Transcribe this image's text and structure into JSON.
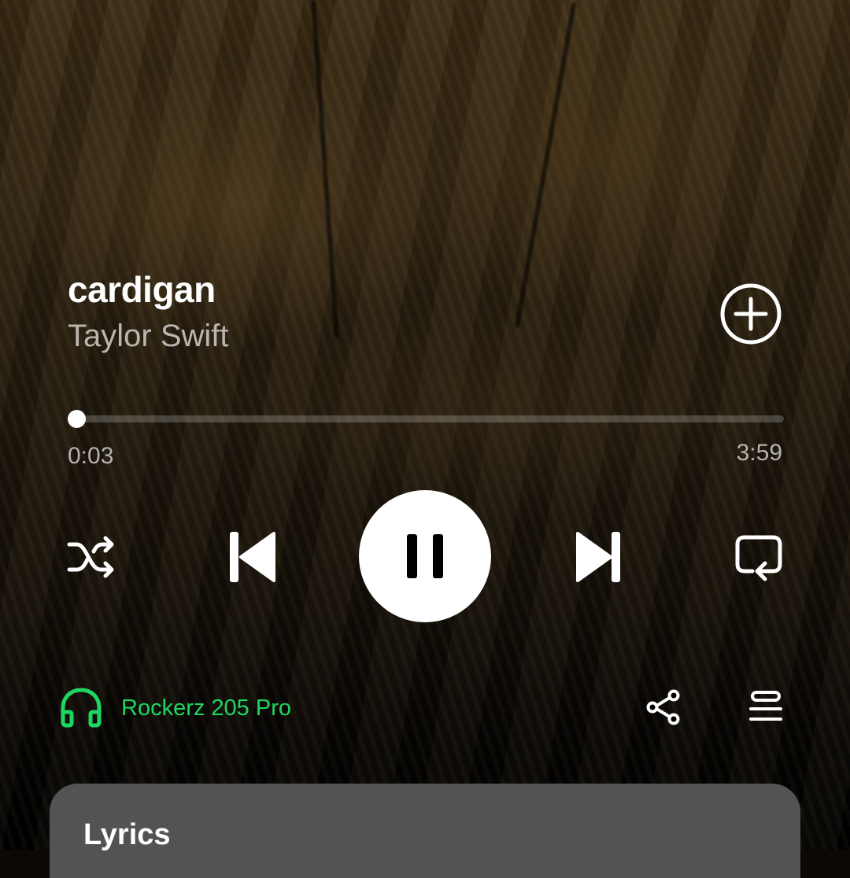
{
  "track": {
    "title": "cardigan",
    "artist": "Taylor Swift"
  },
  "progress": {
    "elapsed": "0:03",
    "total": "3:59",
    "fraction": 0.012
  },
  "controls": {
    "shuffle_icon": "shuffle-icon",
    "previous_icon": "skip-previous-icon",
    "play_state_icon": "pause-icon",
    "next_icon": "skip-next-icon",
    "repeat_icon": "repeat-icon",
    "add_icon": "add-circle-icon"
  },
  "device": {
    "name": "Rockerz 205 Pro",
    "icon": "headphones-icon",
    "color": "#1ed760"
  },
  "actions": {
    "share_icon": "share-icon",
    "queue_icon": "queue-icon"
  },
  "lyrics": {
    "title": "Lyrics",
    "card_color": "#535353"
  }
}
